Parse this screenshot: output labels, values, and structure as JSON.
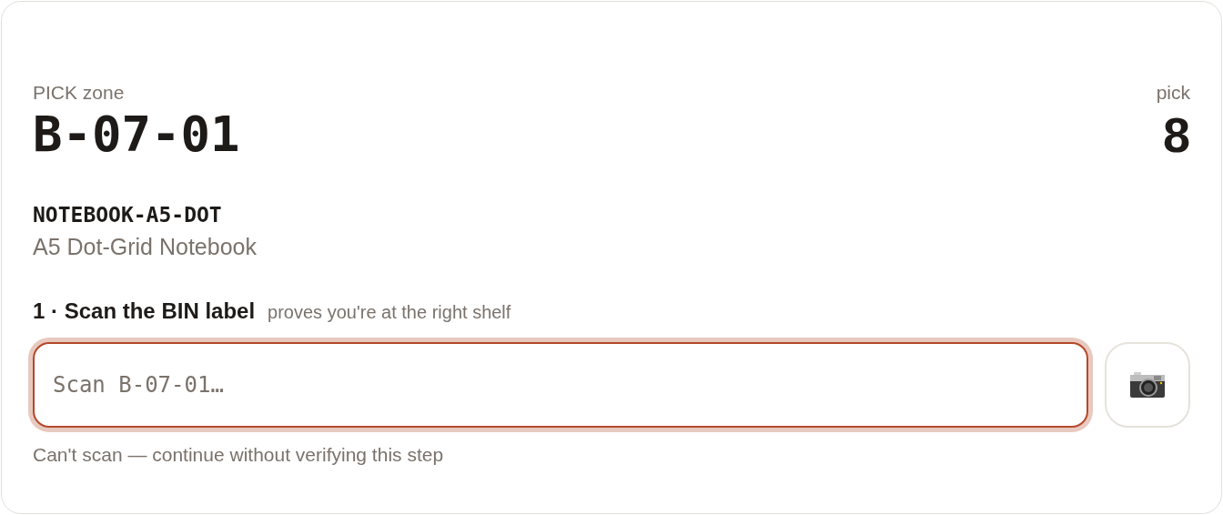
{
  "location": {
    "label": "PICK zone",
    "code": "B-07-01"
  },
  "pick": {
    "label": "pick",
    "count": "8"
  },
  "item": {
    "sku": "NOTEBOOK-A5-DOT",
    "name": "A5 Dot-Grid Notebook"
  },
  "step": {
    "title": "1 · Scan the BIN label",
    "hint": "proves you're at the right shelf"
  },
  "scan_field": {
    "placeholder": "Scan B-07-01…",
    "focused": true
  },
  "skip_link": "Can't scan — continue without verifying this step"
}
